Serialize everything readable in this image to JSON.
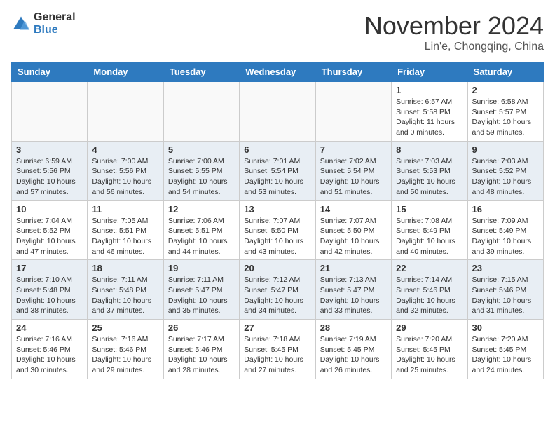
{
  "header": {
    "logo": {
      "general": "General",
      "blue": "Blue"
    },
    "month": "November 2024",
    "location": "Lin'e, Chongqing, China"
  },
  "weekdays": [
    "Sunday",
    "Monday",
    "Tuesday",
    "Wednesday",
    "Thursday",
    "Friday",
    "Saturday"
  ],
  "weeks": [
    [
      {
        "day": "",
        "info": ""
      },
      {
        "day": "",
        "info": ""
      },
      {
        "day": "",
        "info": ""
      },
      {
        "day": "",
        "info": ""
      },
      {
        "day": "",
        "info": ""
      },
      {
        "day": "1",
        "info": "Sunrise: 6:57 AM\nSunset: 5:58 PM\nDaylight: 11 hours\nand 0 minutes."
      },
      {
        "day": "2",
        "info": "Sunrise: 6:58 AM\nSunset: 5:57 PM\nDaylight: 10 hours\nand 59 minutes."
      }
    ],
    [
      {
        "day": "3",
        "info": "Sunrise: 6:59 AM\nSunset: 5:56 PM\nDaylight: 10 hours\nand 57 minutes."
      },
      {
        "day": "4",
        "info": "Sunrise: 7:00 AM\nSunset: 5:56 PM\nDaylight: 10 hours\nand 56 minutes."
      },
      {
        "day": "5",
        "info": "Sunrise: 7:00 AM\nSunset: 5:55 PM\nDaylight: 10 hours\nand 54 minutes."
      },
      {
        "day": "6",
        "info": "Sunrise: 7:01 AM\nSunset: 5:54 PM\nDaylight: 10 hours\nand 53 minutes."
      },
      {
        "day": "7",
        "info": "Sunrise: 7:02 AM\nSunset: 5:54 PM\nDaylight: 10 hours\nand 51 minutes."
      },
      {
        "day": "8",
        "info": "Sunrise: 7:03 AM\nSunset: 5:53 PM\nDaylight: 10 hours\nand 50 minutes."
      },
      {
        "day": "9",
        "info": "Sunrise: 7:03 AM\nSunset: 5:52 PM\nDaylight: 10 hours\nand 48 minutes."
      }
    ],
    [
      {
        "day": "10",
        "info": "Sunrise: 7:04 AM\nSunset: 5:52 PM\nDaylight: 10 hours\nand 47 minutes."
      },
      {
        "day": "11",
        "info": "Sunrise: 7:05 AM\nSunset: 5:51 PM\nDaylight: 10 hours\nand 46 minutes."
      },
      {
        "day": "12",
        "info": "Sunrise: 7:06 AM\nSunset: 5:51 PM\nDaylight: 10 hours\nand 44 minutes."
      },
      {
        "day": "13",
        "info": "Sunrise: 7:07 AM\nSunset: 5:50 PM\nDaylight: 10 hours\nand 43 minutes."
      },
      {
        "day": "14",
        "info": "Sunrise: 7:07 AM\nSunset: 5:50 PM\nDaylight: 10 hours\nand 42 minutes."
      },
      {
        "day": "15",
        "info": "Sunrise: 7:08 AM\nSunset: 5:49 PM\nDaylight: 10 hours\nand 40 minutes."
      },
      {
        "day": "16",
        "info": "Sunrise: 7:09 AM\nSunset: 5:49 PM\nDaylight: 10 hours\nand 39 minutes."
      }
    ],
    [
      {
        "day": "17",
        "info": "Sunrise: 7:10 AM\nSunset: 5:48 PM\nDaylight: 10 hours\nand 38 minutes."
      },
      {
        "day": "18",
        "info": "Sunrise: 7:11 AM\nSunset: 5:48 PM\nDaylight: 10 hours\nand 37 minutes."
      },
      {
        "day": "19",
        "info": "Sunrise: 7:11 AM\nSunset: 5:47 PM\nDaylight: 10 hours\nand 35 minutes."
      },
      {
        "day": "20",
        "info": "Sunrise: 7:12 AM\nSunset: 5:47 PM\nDaylight: 10 hours\nand 34 minutes."
      },
      {
        "day": "21",
        "info": "Sunrise: 7:13 AM\nSunset: 5:47 PM\nDaylight: 10 hours\nand 33 minutes."
      },
      {
        "day": "22",
        "info": "Sunrise: 7:14 AM\nSunset: 5:46 PM\nDaylight: 10 hours\nand 32 minutes."
      },
      {
        "day": "23",
        "info": "Sunrise: 7:15 AM\nSunset: 5:46 PM\nDaylight: 10 hours\nand 31 minutes."
      }
    ],
    [
      {
        "day": "24",
        "info": "Sunrise: 7:16 AM\nSunset: 5:46 PM\nDaylight: 10 hours\nand 30 minutes."
      },
      {
        "day": "25",
        "info": "Sunrise: 7:16 AM\nSunset: 5:46 PM\nDaylight: 10 hours\nand 29 minutes."
      },
      {
        "day": "26",
        "info": "Sunrise: 7:17 AM\nSunset: 5:46 PM\nDaylight: 10 hours\nand 28 minutes."
      },
      {
        "day": "27",
        "info": "Sunrise: 7:18 AM\nSunset: 5:45 PM\nDaylight: 10 hours\nand 27 minutes."
      },
      {
        "day": "28",
        "info": "Sunrise: 7:19 AM\nSunset: 5:45 PM\nDaylight: 10 hours\nand 26 minutes."
      },
      {
        "day": "29",
        "info": "Sunrise: 7:20 AM\nSunset: 5:45 PM\nDaylight: 10 hours\nand 25 minutes."
      },
      {
        "day": "30",
        "info": "Sunrise: 7:20 AM\nSunset: 5:45 PM\nDaylight: 10 hours\nand 24 minutes."
      }
    ]
  ]
}
